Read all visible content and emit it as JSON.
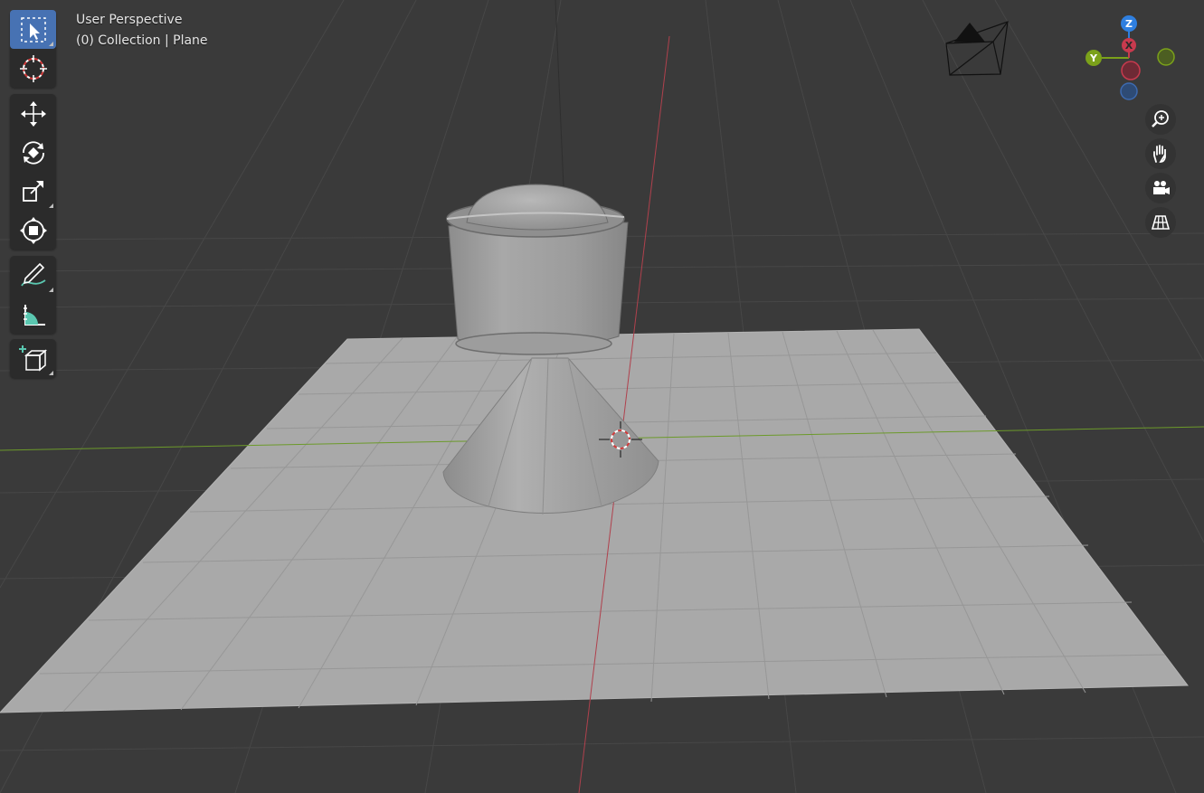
{
  "viewport": {
    "view_name": "User Perspective",
    "collection_info": "(0) Collection | Plane"
  },
  "toolbar": {
    "groups": [
      {
        "tools": [
          {
            "name": "select-box",
            "icon": "select-box-icon",
            "active": true
          },
          {
            "name": "cursor",
            "icon": "cursor-icon",
            "active": false
          }
        ]
      },
      {
        "tools": [
          {
            "name": "move",
            "icon": "move-icon",
            "active": false
          },
          {
            "name": "rotate",
            "icon": "rotate-icon",
            "active": false
          },
          {
            "name": "scale",
            "icon": "scale-icon",
            "active": false
          },
          {
            "name": "transform",
            "icon": "transform-icon",
            "active": false
          }
        ]
      },
      {
        "tools": [
          {
            "name": "annotate",
            "icon": "annotate-icon",
            "active": false
          },
          {
            "name": "measure",
            "icon": "measure-icon",
            "active": false
          }
        ]
      },
      {
        "tools": [
          {
            "name": "add-cube",
            "icon": "add-cube-icon",
            "active": false
          }
        ]
      }
    ]
  },
  "navigation_gizmo": {
    "axes": {
      "x": {
        "label": "X",
        "color": "#c83a4e"
      },
      "y": {
        "label": "Y",
        "color": "#7ba11a"
      },
      "z": {
        "label": "Z",
        "color": "#2f7fdf"
      }
    },
    "buttons": [
      {
        "name": "zoom",
        "icon": "zoom-icon"
      },
      {
        "name": "pan",
        "icon": "hand-icon"
      },
      {
        "name": "camera-view",
        "icon": "camera-icon"
      },
      {
        "name": "toggle-projection",
        "icon": "grid-icon"
      }
    ]
  },
  "colors": {
    "background": "#3a3a3a",
    "grid": "#474747",
    "plane": "#a9a9a9",
    "x_axis": "#b0414d",
    "y_axis": "#6c9a2a",
    "active_tool": "#4772b3"
  }
}
